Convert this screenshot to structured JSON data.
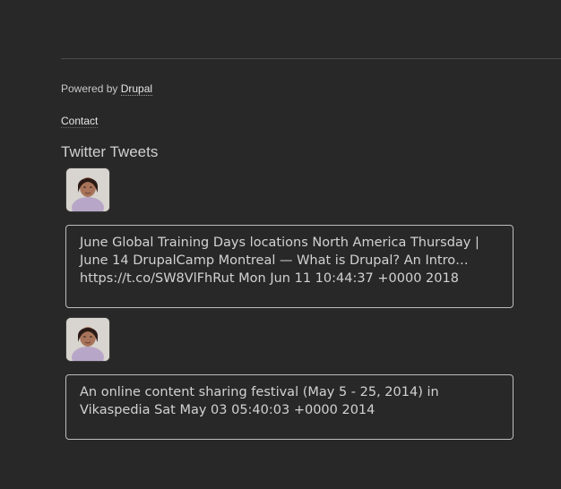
{
  "footer": {
    "powered_prefix": "Powered by",
    "powered_link": "Drupal",
    "contact_link": "Contact"
  },
  "twitter_block": {
    "title": "Twitter Tweets",
    "tweets": [
      {
        "avatar_icon": "user-avatar-icon",
        "text": "June Global Training Days locations North America Thursday | June 14 DrupalCamp Montreal — What is Drupal? An Intro… https://t.co/SW8VlFhRut Mon Jun 11 10:44:37 +0000 2018"
      },
      {
        "avatar_icon": "user-avatar-icon",
        "text": "An online content sharing festival (May 5 - 25, 2014) in Vikaspedia Sat May 03 05:40:03 +0000 2014"
      }
    ]
  },
  "colors": {
    "background": "#282828",
    "text": "#d2d2d2",
    "border": "#bdbdbd"
  }
}
